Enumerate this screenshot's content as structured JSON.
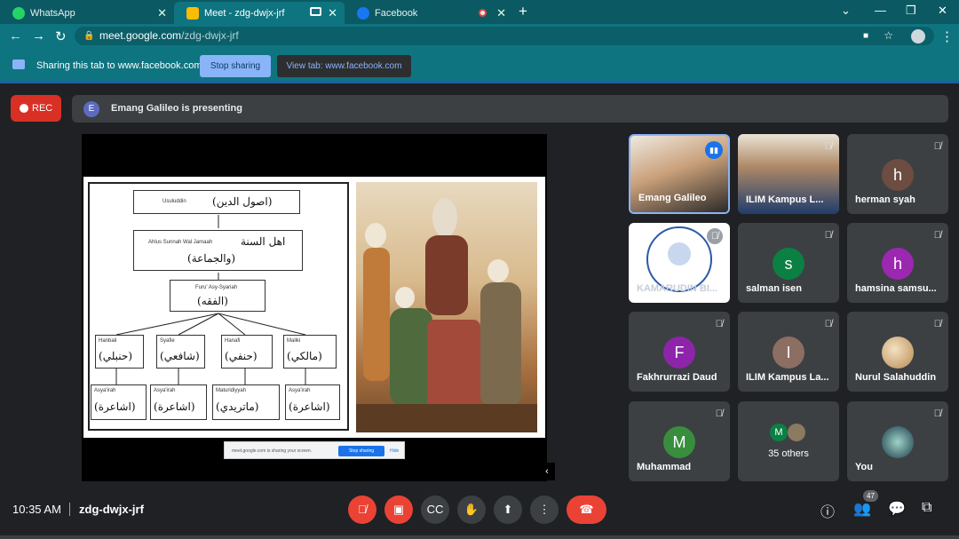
{
  "browser": {
    "tabs": [
      {
        "title": "WhatsApp"
      },
      {
        "title": "Meet - zdg-dwjx-jrf"
      },
      {
        "title": "Facebook"
      }
    ],
    "url_host": "meet.google.com",
    "url_path": "/zdg-dwjx-jrf"
  },
  "sharing": {
    "text": "Sharing this tab to www.facebook.com",
    "stop_label": "Stop sharing",
    "view_label": "View tab: www.facebook.com"
  },
  "meet": {
    "rec_label": "REC",
    "presenter_initial": "E",
    "presenting_text": "Emang Galileo is presenting",
    "time": "10:35 AM",
    "code": "zdg-dwjx-jrf",
    "participant_count": "47"
  },
  "slide": {
    "usul_latin": "Usuluddin",
    "usul_ar": "(اصول الدين)",
    "ahlus_latin": "Ahlus Sunnah Wal Jamaah",
    "ahlus_ar1": "اهل السنة",
    "ahlus_ar2": "(والجماعة)",
    "furu_latin": "Furu' Asy-Syariah",
    "furu_ar": "(الفقه)",
    "madhhabs": [
      {
        "latin": "Hanbali",
        "ar": "(حنبلي)"
      },
      {
        "latin": "Syafie",
        "ar": "(شافعي)"
      },
      {
        "latin": "Hanafi",
        "ar": "(حنفي)"
      },
      {
        "latin": "Maliki",
        "ar": "(مالكي)"
      }
    ],
    "aqidah": [
      {
        "latin": "Asya'irah",
        "ar": "(اشاعرة)"
      },
      {
        "latin": "Asya'irah",
        "ar": "(اشاعرة)"
      },
      {
        "latin": "Maturidiyyah",
        "ar": "(ماتريدي)"
      },
      {
        "latin": "Asya'irah",
        "ar": "(اشاعرة)"
      }
    ],
    "notice_text": "meet.google.com is sharing your screen.",
    "notice_stop": "Stop sharing",
    "notice_hide": "Hide"
  },
  "participants": [
    {
      "name": "Emang Galileo",
      "initial": "",
      "color": "#5b4a3a",
      "speaking": true
    },
    {
      "name": "ILIM Kampus L...",
      "initial": "",
      "color": "#6b5a48",
      "speaking": false
    },
    {
      "name": "herman syah",
      "initial": "h",
      "color": "#6d4c41",
      "speaking": false
    },
    {
      "name": "KAMARUDIN BI...",
      "initial": "",
      "color": "#ffffff",
      "speaking": false
    },
    {
      "name": "salman isen",
      "initial": "s",
      "color": "#0b8043",
      "speaking": false
    },
    {
      "name": "hamsina samsu...",
      "initial": "h",
      "color": "#9c27b0",
      "speaking": false
    },
    {
      "name": "Fakhrurrazi Daud",
      "initial": "F",
      "color": "#8e24aa",
      "speaking": false
    },
    {
      "name": "ILIM Kampus La...",
      "initial": "I",
      "color": "#8d6e63",
      "speaking": false
    },
    {
      "name": "Nurul Salahuddin",
      "initial": "",
      "color": "#c9a26b",
      "speaking": false
    },
    {
      "name": "Muhammad",
      "initial": "M",
      "color": "#388e3c",
      "speaking": false
    },
    {
      "name": "35 others",
      "initial": "M",
      "color": "#0b8043",
      "speaking": false
    },
    {
      "name": "You",
      "initial": "",
      "color": "#1b3a4a",
      "speaking": false
    }
  ],
  "logo_text": "MAHKAMAH ANAK NEGERI TUNGKU",
  "colors": {
    "tab_bg": "#0b5a63",
    "toolbar": "#0e7480",
    "meet_bg": "#202124",
    "tile_bg": "#3c4043",
    "danger": "#ea4335",
    "accent": "#8ab4f8"
  }
}
